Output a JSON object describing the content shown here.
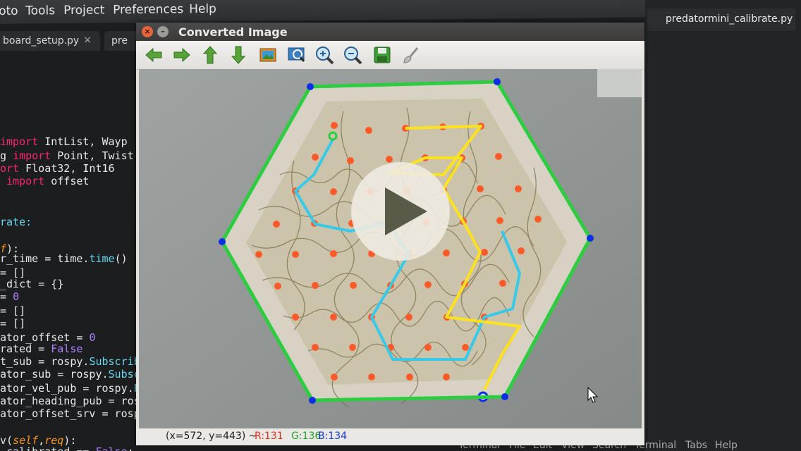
{
  "menubar": {
    "items": [
      "oto",
      "Tools",
      "Project",
      "Preferences",
      "Help"
    ]
  },
  "editor_tabs": [
    "board_setup.py",
    "pre"
  ],
  "right_tab": "predatormini_calibrate.py",
  "code_lines": [
    [
      {
        "t": "import",
        "c": "kw"
      },
      {
        "t": " IntList, Wayp",
        "c": ""
      }
    ],
    [
      {
        "t": "g ",
        "c": ""
      },
      {
        "t": "import",
        "c": "kw"
      },
      {
        "t": " Point, Twist",
        "c": ""
      }
    ],
    [
      {
        "t": "ort",
        "c": "kw"
      },
      {
        "t": " Float32, Int16",
        "c": ""
      }
    ],
    [
      {
        "t": " ",
        "c": ""
      },
      {
        "t": "import",
        "c": "kw"
      },
      {
        "t": " offset",
        "c": ""
      }
    ],
    [
      {
        "t": "rate:",
        "c": "fn"
      }
    ],
    [
      {
        "t": "f",
        "c": "it"
      },
      {
        "t": "):",
        "c": ""
      }
    ],
    [
      {
        "t": "r_time = time.",
        "c": ""
      },
      {
        "t": "time",
        "c": "fn"
      },
      {
        "t": "()",
        "c": ""
      }
    ],
    [
      {
        "t": "= []",
        "c": ""
      }
    ],
    [
      {
        "t": "_dict = {}",
        "c": ""
      }
    ],
    [
      {
        "t": "= ",
        "c": ""
      },
      {
        "t": "0",
        "c": "num"
      }
    ],
    [
      {
        "t": "= []",
        "c": ""
      }
    ],
    [
      {
        "t": "= []",
        "c": ""
      }
    ],
    [
      {
        "t": "ator_offset = ",
        "c": ""
      },
      {
        "t": "0",
        "c": "num"
      }
    ],
    [
      {
        "t": "rated = ",
        "c": ""
      },
      {
        "t": "False",
        "c": "num"
      }
    ],
    [
      {
        "t": "t_sub = rospy.",
        "c": ""
      },
      {
        "t": "Subscriber",
        "c": "fn"
      }
    ],
    [
      {
        "t": "ator_sub = rospy.",
        "c": ""
      },
      {
        "t": "Subscrib",
        "c": "fn"
      }
    ],
    [
      {
        "t": "ator_vel_pub = rospy.",
        "c": ""
      },
      {
        "t": "Publ",
        "c": "fn"
      }
    ],
    [
      {
        "t": "ator_heading_pub = rospy.",
        "c": ""
      }
    ],
    [
      {
        "t": "ator_offset_srv = rospy.",
        "c": ""
      },
      {
        "t": "S",
        "c": "fn"
      }
    ],
    [
      {
        "t": "v(",
        "c": ""
      },
      {
        "t": "self",
        "c": "it"
      },
      {
        "t": ",",
        "c": ""
      },
      {
        "t": "req",
        "c": "it"
      },
      {
        "t": "):",
        "c": ""
      }
    ],
    [
      {
        "t": "_calibrated == ",
        "c": ""
      },
      {
        "t": "False",
        "c": "num"
      },
      {
        "t": ":",
        "c": ""
      }
    ]
  ],
  "bottom_menu": [
    "Terminal",
    "File",
    "Edit",
    "View",
    "Search",
    "Terminal",
    "Tabs",
    "Help"
  ],
  "viewer": {
    "title": "Converted Image",
    "close_glyph": "×",
    "minimize_glyph": "–",
    "toolbar_icons": [
      "arrow-left-icon",
      "arrow-right-icon",
      "arrow-up-icon",
      "arrow-down-icon",
      "image-icon",
      "zoom-fit-icon",
      "zoom-in-icon",
      "zoom-out-icon",
      "save-icon",
      "brush-icon"
    ],
    "status": {
      "coords": "(x=572, y=443) ~",
      "r": "R:131",
      "g": "G:136",
      "b": "B:134"
    },
    "colors": {
      "boundary": "#2ecc40",
      "corner": "#0b2ee6",
      "grid": "#ff5a2a",
      "path_yellow": "#ffe21f",
      "path_cyan": "#38c9e8"
    }
  }
}
